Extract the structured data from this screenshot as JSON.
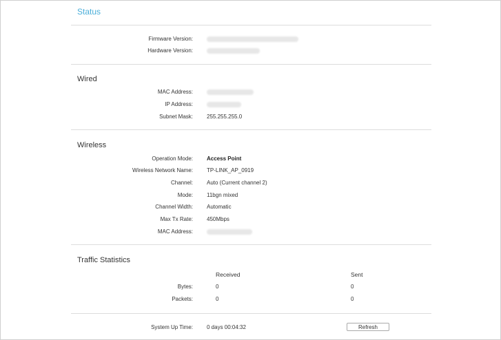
{
  "header": {
    "title": "Status"
  },
  "system": {
    "firmware_label": "Firmware Version:",
    "hardware_label": "Hardware Version:"
  },
  "wired": {
    "title": "Wired",
    "mac_label": "MAC Address:",
    "ip_label": "IP Address:",
    "subnet_label": "Subnet Mask:",
    "subnet_value": "255.255.255.0"
  },
  "wireless": {
    "title": "Wireless",
    "operation_mode_label": "Operation Mode:",
    "operation_mode_value": "Access Point",
    "network_name_label": "Wireless Network Name:",
    "network_name_value": "TP-LINK_AP_0919",
    "channel_label": "Channel:",
    "channel_value": "Auto (Current channel 2)",
    "mode_label": "Mode:",
    "mode_value": "11bgn mixed",
    "channel_width_label": "Channel Width:",
    "channel_width_value": "Automatic",
    "max_tx_label": "Max Tx Rate:",
    "max_tx_value": "450Mbps",
    "mac_label": "MAC Address:"
  },
  "traffic": {
    "title": "Traffic Statistics",
    "received_header": "Received",
    "sent_header": "Sent",
    "bytes_label": "Bytes:",
    "bytes_received": "0",
    "bytes_sent": "0",
    "packets_label": "Packets:",
    "packets_received": "0",
    "packets_sent": "0"
  },
  "footer": {
    "uptime_label": "System Up Time:",
    "uptime_value": "0 days 00:04:32",
    "refresh_label": "Refresh"
  }
}
